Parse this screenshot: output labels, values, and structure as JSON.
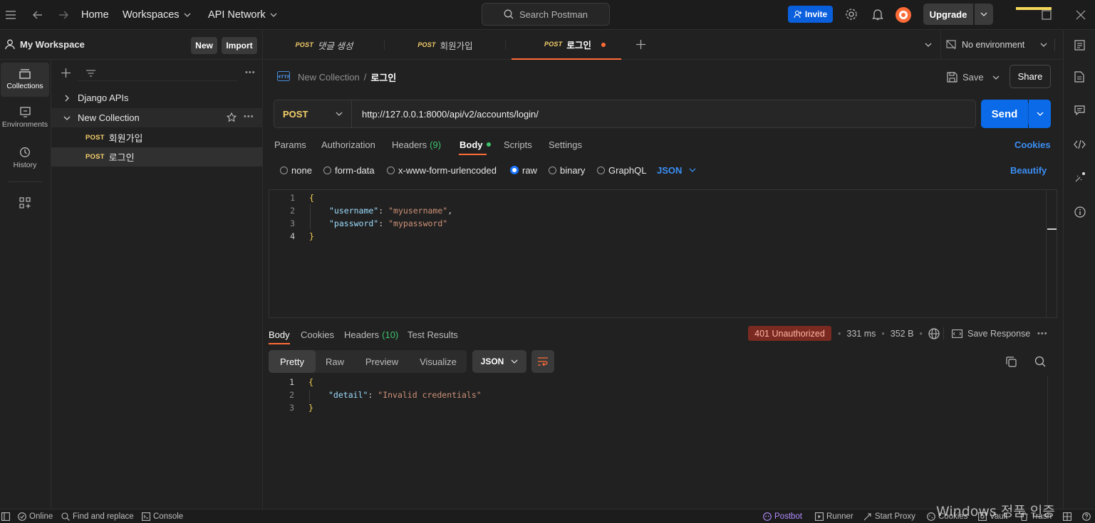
{
  "topbar": {
    "home": "Home",
    "workspaces": "Workspaces",
    "api_network": "API Network",
    "search_placeholder": "Search Postman",
    "invite": "Invite",
    "upgrade": "Upgrade"
  },
  "workspace": {
    "name": "My Workspace",
    "new_label": "New",
    "import_label": "Import"
  },
  "rail": {
    "collections": "Collections",
    "environments": "Environments",
    "history": "History"
  },
  "sidebar": {
    "items": [
      {
        "label": "Django APIs"
      },
      {
        "label": "New Collection"
      },
      {
        "method": "POST",
        "label": "회원가입"
      },
      {
        "method": "POST",
        "label": "로그인"
      }
    ]
  },
  "tabs": [
    {
      "method": "POST",
      "label": "댓글 생성"
    },
    {
      "method": "POST",
      "label": "회원가입"
    },
    {
      "method": "POST",
      "label": "로그인"
    }
  ],
  "environment": {
    "label": "No environment"
  },
  "breadcrumb": {
    "collection": "New Collection",
    "separator": "/",
    "request": "로그인",
    "save": "Save",
    "share": "Share"
  },
  "request": {
    "method": "POST",
    "url": "http://127.0.0.1:8000/api/v2/accounts/login/",
    "send": "Send"
  },
  "request_tabs": {
    "params": "Params",
    "authorization": "Authorization",
    "headers": "Headers",
    "headers_count": "(9)",
    "body": "Body",
    "scripts": "Scripts",
    "settings": "Settings",
    "cookies": "Cookies"
  },
  "body_types": {
    "none": "none",
    "form_data": "form-data",
    "urlencoded": "x-www-form-urlencoded",
    "raw": "raw",
    "binary": "binary",
    "graphql": "GraphQL",
    "format": "JSON",
    "beautify": "Beautify"
  },
  "request_body": {
    "line_numbers": [
      "1",
      "2",
      "3",
      "4"
    ],
    "open": "{",
    "k1": "\"username\"",
    "v1": "\"myusername\"",
    "k2": "\"password\"",
    "v2": "\"mypassword\"",
    "close": "}",
    "colon": ":",
    "comma": ","
  },
  "response": {
    "tabs": {
      "body": "Body",
      "cookies": "Cookies",
      "headers": "Headers",
      "headers_count": "(10)",
      "test_results": "Test Results"
    },
    "status": "401 Unauthorized",
    "time": "331 ms",
    "size": "352 B",
    "save_response": "Save Response",
    "views": {
      "pretty": "Pretty",
      "raw": "Raw",
      "preview": "Preview",
      "visualize": "Visualize",
      "format": "JSON"
    },
    "line_numbers": [
      "1",
      "2",
      "3"
    ],
    "open": "{",
    "key": "\"detail\"",
    "value": "\"Invalid credentials\"",
    "close": "}",
    "colon": ":"
  },
  "statusbar": {
    "online": "Online",
    "find_replace": "Find and replace",
    "console": "Console",
    "postbot": "Postbot",
    "runner": "Runner",
    "start_proxy": "Start Proxy",
    "cookies": "Cookies",
    "vault": "Vault",
    "trash": "Trash"
  },
  "watermark": "Windows 정품 인증",
  "colors": {
    "accent_orange": "#ff6c37",
    "send_blue": "#0a6ae8",
    "post_yellow": "#f6d06a",
    "error_badge": "#7a2a20"
  }
}
